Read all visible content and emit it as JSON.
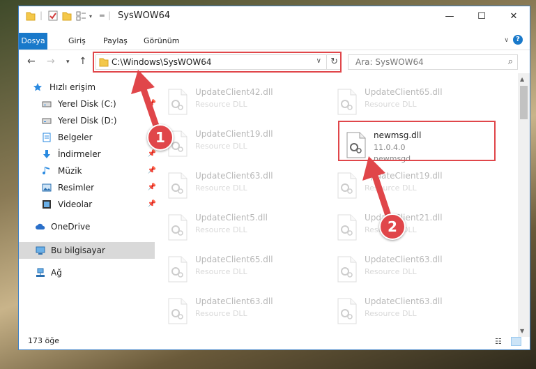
{
  "window": {
    "title": "SysWOW64",
    "controls": {
      "minimize": "—",
      "maximize": "☐",
      "close": "✕"
    }
  },
  "ribbon": {
    "tabs": [
      {
        "label": "Dosya",
        "active": true
      },
      {
        "label": "Giriş",
        "active": false
      },
      {
        "label": "Paylaş",
        "active": false
      },
      {
        "label": "Görünüm",
        "active": false
      }
    ],
    "help": "?"
  },
  "address": {
    "path": "C:\\Windows\\SysWOW64",
    "search_placeholder": "Ara: SysWOW64"
  },
  "sidebar": {
    "items": [
      {
        "label": "Hızlı erişim",
        "icon": "star-icon"
      },
      {
        "label": "Yerel Disk (C:)",
        "icon": "drive-icon"
      },
      {
        "label": "Yerel Disk (D:)",
        "icon": "drive-icon"
      },
      {
        "label": "Belgeler",
        "icon": "documents-icon"
      },
      {
        "label": "İndirmeler",
        "icon": "download-icon"
      },
      {
        "label": "Müzik",
        "icon": "music-icon"
      },
      {
        "label": "Resimler",
        "icon": "pictures-icon"
      },
      {
        "label": "Videolar",
        "icon": "videos-icon"
      },
      {
        "label": "OneDrive",
        "icon": "cloud-icon"
      },
      {
        "label": "Bu bilgisayar",
        "icon": "computer-icon",
        "selected": true
      },
      {
        "label": "Ağ",
        "icon": "network-icon"
      }
    ]
  },
  "files": [
    {
      "name": "UpdateClient42.dll",
      "type": "Resource DLL"
    },
    {
      "name": "UpdateClient65.dll",
      "type": "Resource DLL"
    },
    {
      "name": "UpdateClient19.dll",
      "type": "Resource DLL"
    },
    {
      "name": "newmsg.dll",
      "version": "11.0.4.0",
      "desc": "newmsgd",
      "highlight": true
    },
    {
      "name": "UpdateClient63.dll",
      "type": "Resource DLL"
    },
    {
      "name": "UpdateClient19.dll",
      "type": "Resource DLL"
    },
    {
      "name": "UpdateClient5.dll",
      "type": "Resource DLL"
    },
    {
      "name": "UpdateClient21.dll",
      "type": "Resource DLL"
    },
    {
      "name": "UpdateClient65.dll",
      "type": "Resource DLL"
    },
    {
      "name": "UpdateClient63.dll",
      "type": "Resource DLL"
    },
    {
      "name": "UpdateClient63.dll",
      "type": "Resource DLL"
    },
    {
      "name": "UpdateClient63.dll",
      "type": "Resource DLL"
    }
  ],
  "status": {
    "count": "173 öğe"
  },
  "annotations": {
    "step1": "1",
    "step2": "2",
    "color": "#e0464a"
  }
}
